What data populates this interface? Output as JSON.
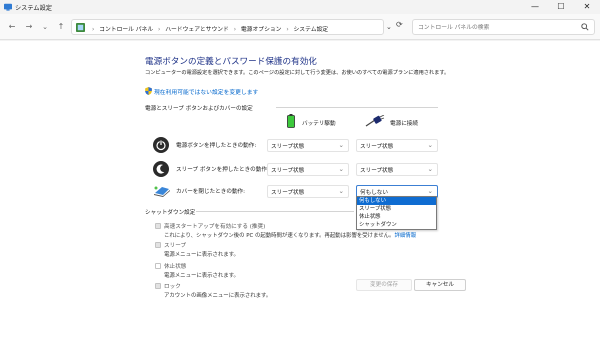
{
  "window": {
    "title": "システム設定",
    "min": "—",
    "max": "☐",
    "close": "✕"
  },
  "nav": {
    "back": "←",
    "forward": "→",
    "recent": "⌄",
    "up": "↑"
  },
  "breadcrumbs": {
    "sep0": "›",
    "items": [
      "コントロール パネル",
      "ハードウェアとサウンド",
      "電源オプション",
      "システム設定"
    ],
    "sep": "›",
    "dropdown": "⌄",
    "refresh": "⟳"
  },
  "search": {
    "placeholder": "コントロール パネルの検索"
  },
  "page": {
    "heading": "電源ボタンの定義とパスワード保護の有効化",
    "description": "コンピューターの電源設定を選択できます。このページの設定に対して行う変更は、お使いのすべての電源プランに適用されます。",
    "change_link": "現在利用可能ではない設定を変更します"
  },
  "power_section": {
    "header": "電源とスリープ ボタンおよびカバーの設定",
    "col_battery": "バッテリ駆動",
    "col_plugged": "電源に接続",
    "rows": [
      {
        "label": "電源ボタンを押したときの動作:",
        "battery": "スリープ状態",
        "plugged": "スリープ状態"
      },
      {
        "label": "スリープ ボタンを押したときの動作:",
        "battery": "スリープ状態",
        "plugged": "スリープ状態"
      },
      {
        "label": "カバーを閉じたときの動作:",
        "battery": "スリープ状態",
        "plugged": "何もしない"
      }
    ],
    "chevron": "⌄",
    "dropdown_options": [
      "何もしない",
      "スリープ状態",
      "休止状態",
      "シャットダウン"
    ]
  },
  "shutdown_section": {
    "header": "シャットダウン設定",
    "items": [
      {
        "label": "高速スタートアップを有効にする (推奨)",
        "desc": "これにより、シャットダウン後の PC の起動時間が速くなります。再起動は影響を受けません。",
        "link": "詳細情報"
      },
      {
        "label": "スリープ",
        "desc": "電源メニューに表示されます。"
      },
      {
        "label": "休止状態",
        "desc": "電源メニューに表示されます。"
      },
      {
        "label": "ロック",
        "desc": "アカウントの画像メニューに表示されます。"
      }
    ]
  },
  "buttons": {
    "save": "変更の保存",
    "cancel": "キャンセル"
  },
  "colors": {
    "heading": "#1e3287",
    "link": "#0066cc",
    "selection": "#0f6cd1",
    "battery": "#3cc93c"
  }
}
